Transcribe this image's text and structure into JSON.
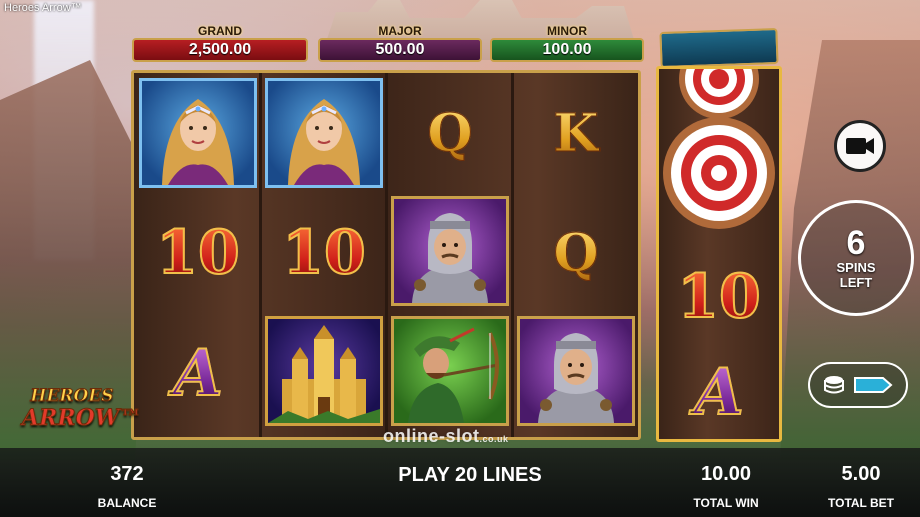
{
  "window": {
    "title": "Heroes Arrow™"
  },
  "jackpots": {
    "grand": {
      "label": "GRAND",
      "value": "2,500.00",
      "color": "#b61e22"
    },
    "major": {
      "label": "MAJOR",
      "value": "500.00",
      "color": "#6b2a5e"
    },
    "minor": {
      "label": "MINOR",
      "value": "100.00",
      "color": "#2e8a3a"
    }
  },
  "reels": [
    [
      "princess",
      "10",
      "A"
    ],
    [
      "princess",
      "10",
      "castle"
    ],
    [
      "Q",
      "knight",
      "archer"
    ],
    [
      "K",
      "Q",
      "knight"
    ]
  ],
  "side_reel": [
    "target",
    "target",
    "10",
    "A"
  ],
  "symbols": {
    "ten": "10",
    "queen": "Q",
    "king": "K",
    "ace": "A"
  },
  "free_spins": {
    "count": "6",
    "label_line1": "SPINS",
    "label_line2": "LEFT"
  },
  "logo": {
    "line1": "HEROES",
    "line2": "ARROW™"
  },
  "watermark": {
    "text": "online-slot",
    "suffix": ".co.uk"
  },
  "bottom_bar": {
    "balance": {
      "value": "372",
      "label": "BALANCE"
    },
    "play_lines": "PLAY 20 LINES",
    "total_win": {
      "value": "10.00",
      "label": "TOTAL WIN"
    },
    "total_bet": {
      "value": "5.00",
      "label": "TOTAL BET"
    }
  },
  "colors": {
    "frame_gold": "#c9a04a",
    "reel_wood": "#3d2519"
  }
}
